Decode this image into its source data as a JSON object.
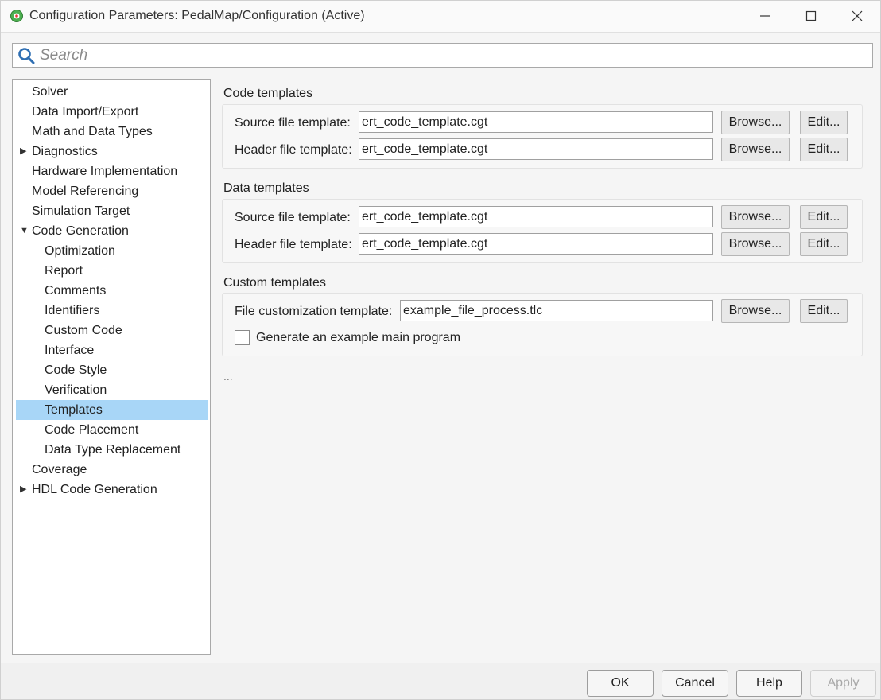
{
  "window": {
    "title": "Configuration Parameters: PedalMap/Configuration (Active)",
    "icon": "gear-app-icon",
    "controls": [
      "minimize-icon",
      "maximize-icon",
      "close-icon"
    ]
  },
  "search": {
    "placeholder": "Search",
    "value": ""
  },
  "tree": {
    "items": [
      {
        "label": "Solver",
        "level": 0
      },
      {
        "label": "Data Import/Export",
        "level": 0
      },
      {
        "label": "Math and Data Types",
        "level": 0
      },
      {
        "label": "Diagnostics",
        "level": 0,
        "expander": "collapsed"
      },
      {
        "label": "Hardware Implementation",
        "level": 0
      },
      {
        "label": "Model Referencing",
        "level": 0
      },
      {
        "label": "Simulation Target",
        "level": 0
      },
      {
        "label": "Code Generation",
        "level": 0,
        "expander": "expanded"
      },
      {
        "label": "Optimization",
        "level": 1
      },
      {
        "label": "Report",
        "level": 1
      },
      {
        "label": "Comments",
        "level": 1
      },
      {
        "label": "Identifiers",
        "level": 1
      },
      {
        "label": "Custom Code",
        "level": 1
      },
      {
        "label": "Interface",
        "level": 1
      },
      {
        "label": "Code Style",
        "level": 1
      },
      {
        "label": "Verification",
        "level": 1
      },
      {
        "label": "Templates",
        "level": 1,
        "selected": true
      },
      {
        "label": "Code Placement",
        "level": 1
      },
      {
        "label": "Data Type Replacement",
        "level": 1
      },
      {
        "label": "Coverage",
        "level": 0
      },
      {
        "label": "HDL Code Generation",
        "level": 0,
        "expander": "collapsed"
      }
    ]
  },
  "code_templates": {
    "title": "Code templates",
    "source_label": "Source file template:",
    "source_value": "ert_code_template.cgt",
    "header_label": "Header file template:",
    "header_value": "ert_code_template.cgt"
  },
  "data_templates": {
    "title": "Data templates",
    "source_label": "Source file template:",
    "source_value": "ert_code_template.cgt",
    "header_label": "Header file template:",
    "header_value": "ert_code_template.cgt"
  },
  "custom_templates": {
    "title": "Custom templates",
    "file_label": "File customization template:",
    "file_value": "example_file_process.tlc",
    "checkbox_label": "Generate an example main program",
    "checkbox_checked": false
  },
  "buttons": {
    "browse": "Browse...",
    "edit": "Edit..."
  },
  "more": "...",
  "footer": {
    "ok": "OK",
    "cancel": "Cancel",
    "help": "Help",
    "apply": "Apply"
  },
  "colors": {
    "selection": "#a8d6f7",
    "accent": "#2f6fb3"
  }
}
